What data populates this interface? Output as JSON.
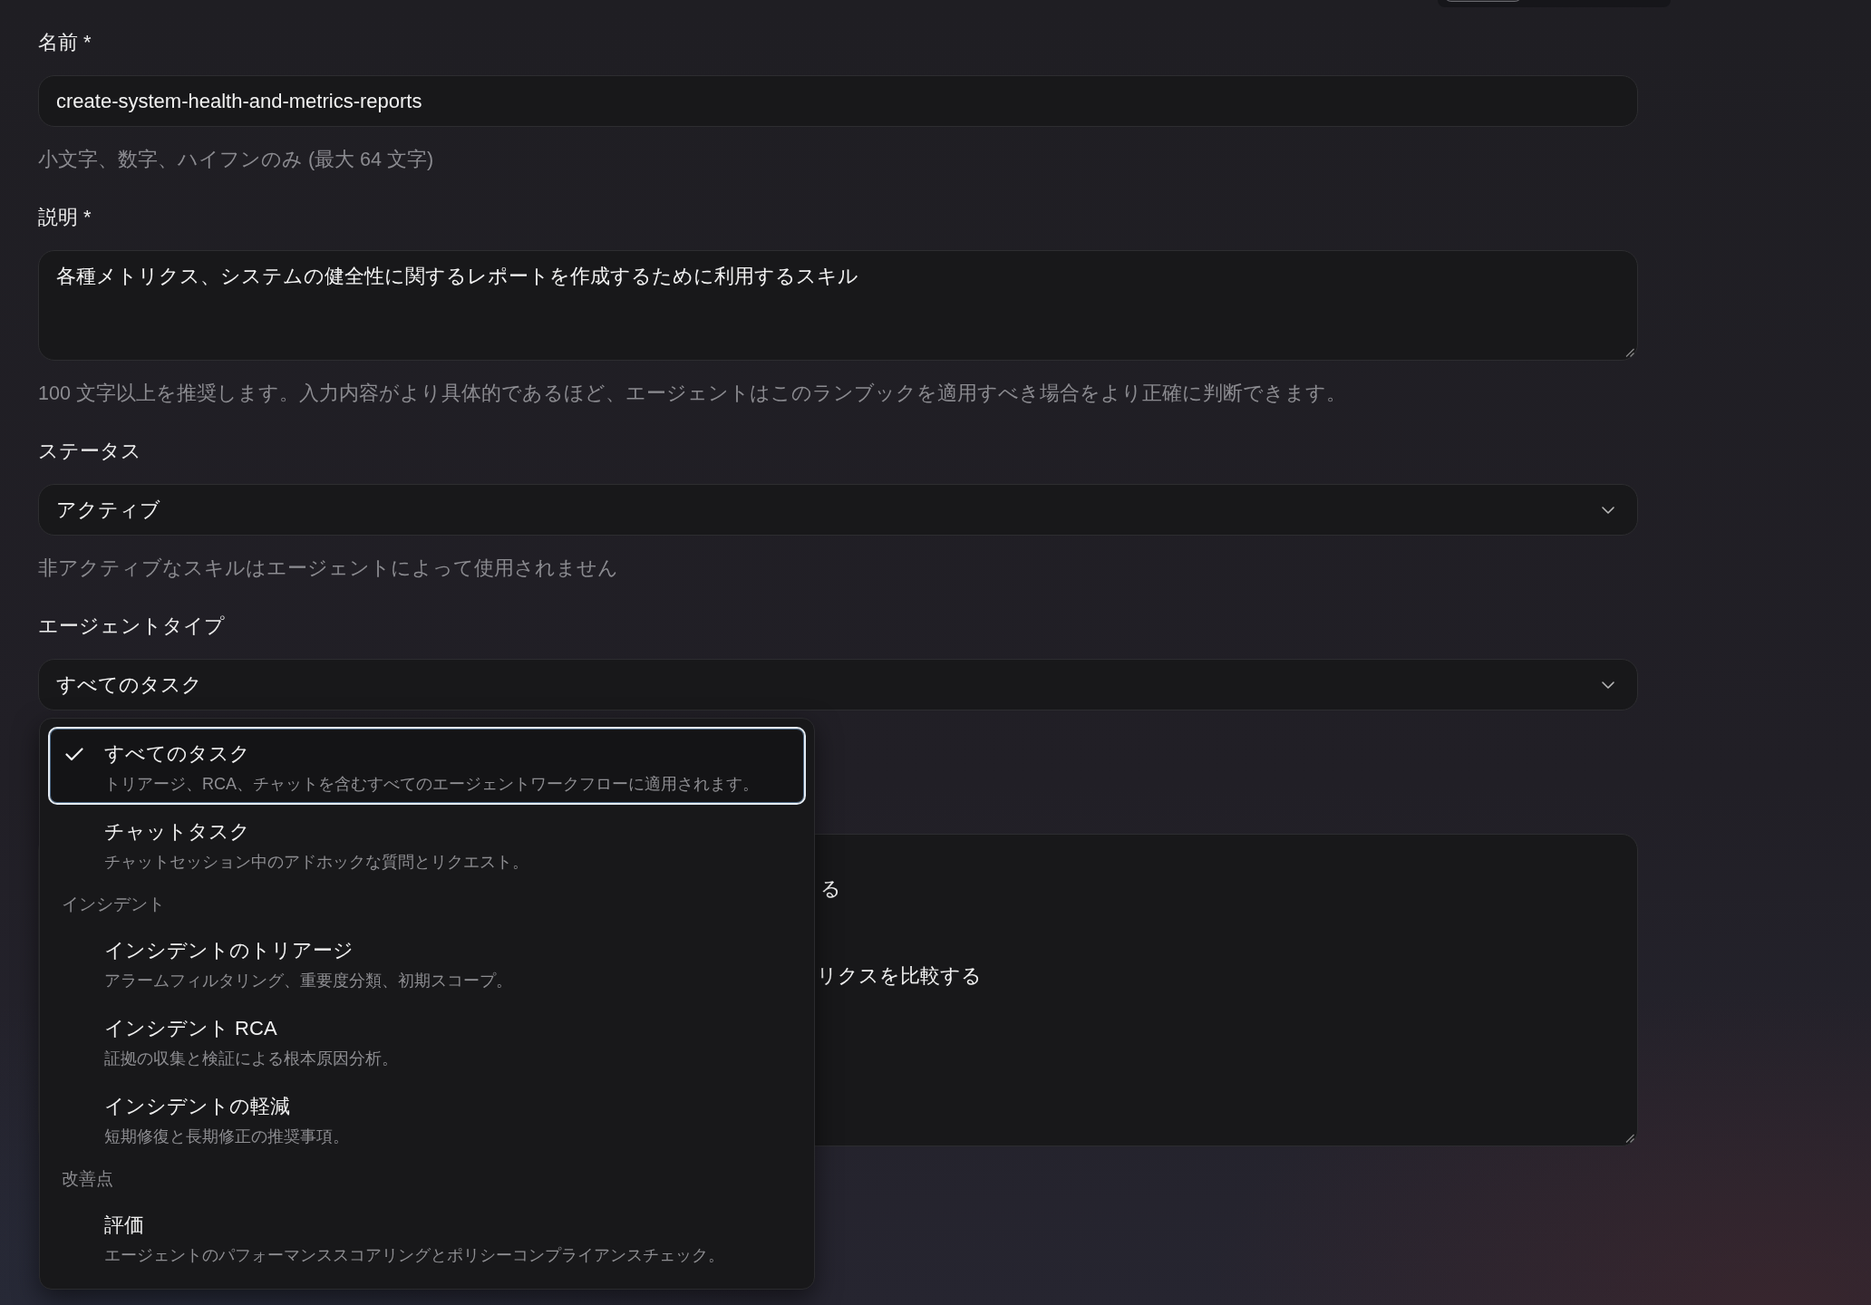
{
  "name_field": {
    "label": "名前 *",
    "value": "create-system-health-and-metrics-reports",
    "hint": "小文字、数字、ハイフンのみ (最大 64 文字)"
  },
  "description_field": {
    "label": "説明 *",
    "value": "各種メトリクス、システムの健全性に関するレポートを作成するために利用するスキル",
    "hint": "100 文字以上を推奨します。入力内容がより具体的であるほど、エージェントはこのランブックを適用すべき場合をより正確に判断できます。"
  },
  "status_field": {
    "label": "ステータス",
    "value": "アクティブ",
    "hint": "非アクティブなスキルはエージェントによって使用されません"
  },
  "agent_type_field": {
    "label": "エージェントタイプ",
    "value": "すべてのタスク",
    "expanded": true,
    "option_groups": [
      {
        "options": [
          {
            "title": "すべてのタスク",
            "description": "トリアージ、RCA、チャットを含むすべてのエージェントワークフローに適用されます。",
            "selected": true
          },
          {
            "title": "チャットタスク",
            "description": "チャットセッション中のアドホックな質問とリクエスト。",
            "selected": false
          }
        ]
      },
      {
        "label": "インシデント",
        "options": [
          {
            "title": "インシデントのトリアージ",
            "description": "アラームフィルタリング、重要度分類、初期スコープ。",
            "selected": false
          },
          {
            "title": "インシデント RCA",
            "description": "証拠の収集と検証による根本原因分析。",
            "selected": false
          },
          {
            "title": "インシデントの軽減",
            "description": "短期修復と長期修正の推奨事項。",
            "selected": false
          }
        ]
      },
      {
        "label": "改善点",
        "options": [
          {
            "title": "評価",
            "description": "エージェントのパフォーマンススコアリングとポリシーコンプライアンスチェック。",
            "selected": false
          }
        ]
      }
    ]
  },
  "partly_hidden_textarea": {
    "visible_lines": [
      "る",
      "リクスを比較する"
    ]
  }
}
